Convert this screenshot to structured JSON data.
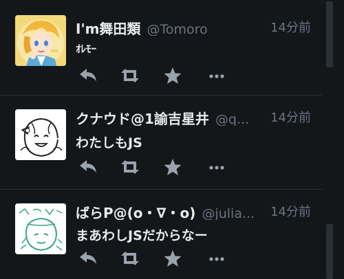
{
  "tweets": [
    {
      "name": "I'm舞田類",
      "handle": "@Tomoro",
      "time": "14分前",
      "text": "ｵﾚﾓｰ",
      "avatar_icon": "anime-character-yellow-hair-avatar"
    },
    {
      "name": "クナウド@1諭吉星井",
      "handle": "@q...",
      "time": "14分前",
      "text": "わたしもJS",
      "avatar_icon": "sketch-girl-avatar"
    },
    {
      "name": "ばらP@(o・∇・o)",
      "handle": "@julia...",
      "time": "14分前",
      "text": "まあわしJSだからなー",
      "avatar_icon": "sketch-girl-green-avatar"
    }
  ],
  "icons": {
    "reply": "reply-icon",
    "retweet": "retweet-icon",
    "favorite": "star-icon",
    "more": "more-icon"
  },
  "colors": {
    "background": "#14171a",
    "text": "#e8eaed",
    "muted": "#6b7280",
    "icon": "#9aa3ad"
  }
}
